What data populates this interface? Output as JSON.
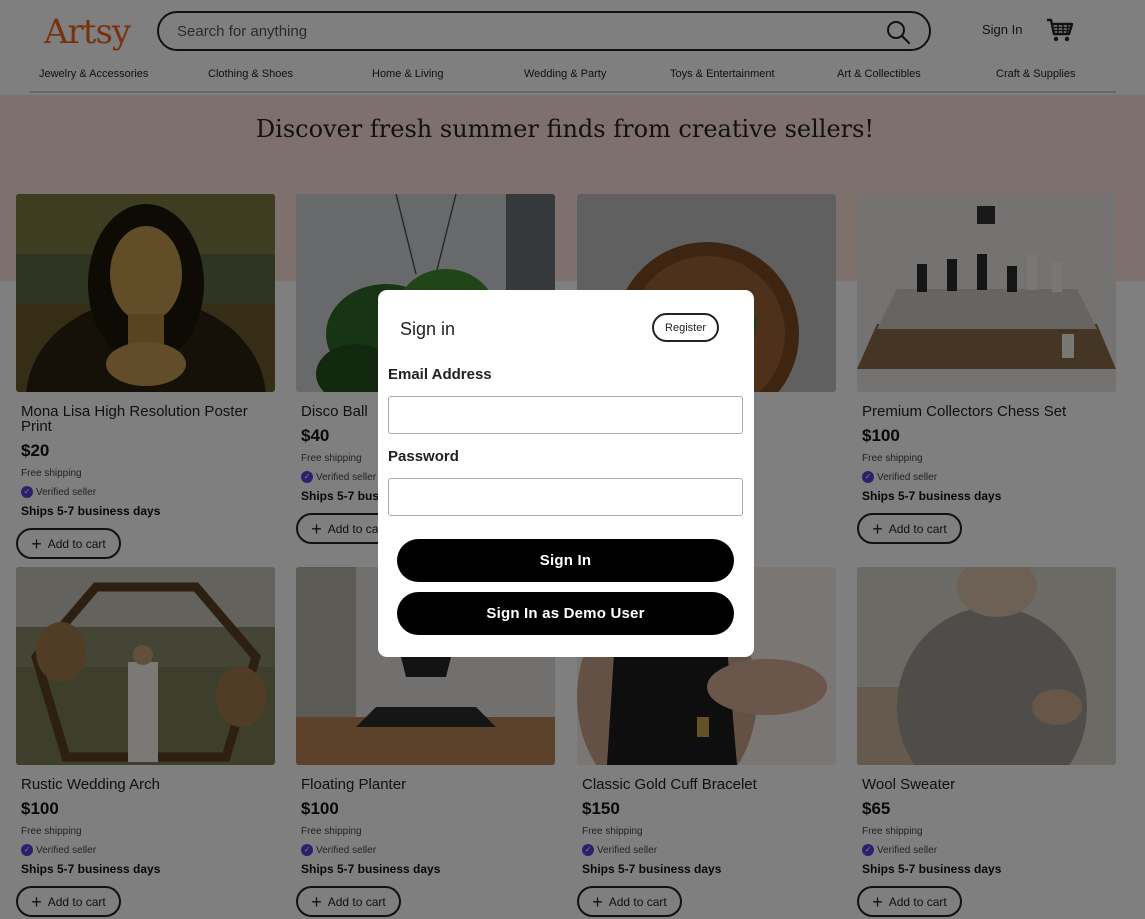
{
  "header": {
    "logo": "Artsy",
    "search_placeholder": "Search for anything",
    "sign_in": "Sign In"
  },
  "categories": [
    "Jewelry & Accessories",
    "Clothing & Shoes",
    "Home & Living",
    "Wedding & Party",
    "Toys & Entertainment",
    "Art & Collectibles",
    "Craft & Supplies"
  ],
  "hero": {
    "title": "Discover fresh summer finds from creative sellers!"
  },
  "products": [
    {
      "title": "Mona Lisa High Resolution Poster Print",
      "price": "$20",
      "shipping": "Free shipping",
      "verified": "Verified seller",
      "ships": "Ships 5-7 business days",
      "add_to_cart": "Add to cart"
    },
    {
      "title": "Disco Ball",
      "price": "$40",
      "shipping": "Free shipping",
      "verified": "Verified seller",
      "ships": "Ships 5-7 business days",
      "add_to_cart": "Add to cart"
    },
    {
      "title": "",
      "price": "",
      "shipping": "",
      "verified": "",
      "ships": "",
      "add_to_cart": ""
    },
    {
      "title": "Premium Collectors Chess Set",
      "price": "$100",
      "shipping": "Free shipping",
      "verified": "Verified seller",
      "ships": "Ships 5-7 business days",
      "add_to_cart": "Add to cart"
    },
    {
      "title": "Rustic Wedding Arch",
      "price": "$100",
      "shipping": "Free shipping",
      "verified": "Verified seller",
      "ships": "Ships 5-7 business days",
      "add_to_cart": "Add to cart"
    },
    {
      "title": "Floating Planter",
      "price": "$100",
      "shipping": "Free shipping",
      "verified": "Verified seller",
      "ships": "Ships 5-7 business days",
      "add_to_cart": "Add to cart"
    },
    {
      "title": "Classic Gold Cuff Bracelet",
      "price": "$150",
      "shipping": "Free shipping",
      "verified": "Verified seller",
      "ships": "Ships 5-7 business days",
      "add_to_cart": "Add to cart"
    },
    {
      "title": "Wool Sweater",
      "price": "$65",
      "shipping": "Free shipping",
      "verified": "Verified seller",
      "ships": "Ships 5-7 business days",
      "add_to_cart": "Add to cart"
    }
  ],
  "modal": {
    "title": "Sign in",
    "register": "Register",
    "email_label": "Email Address",
    "password_label": "Password",
    "sign_in_button": "Sign In",
    "demo_button": "Sign In as Demo User"
  },
  "icons": {
    "search": "search-icon",
    "cart": "cart-icon",
    "plus": "plus-icon",
    "verified": "verified-badge-icon"
  },
  "colors": {
    "brand": "#f1641e",
    "hero_bg": "#fde1d9",
    "verified": "#5b3fd9",
    "primary_button": "#000000"
  }
}
